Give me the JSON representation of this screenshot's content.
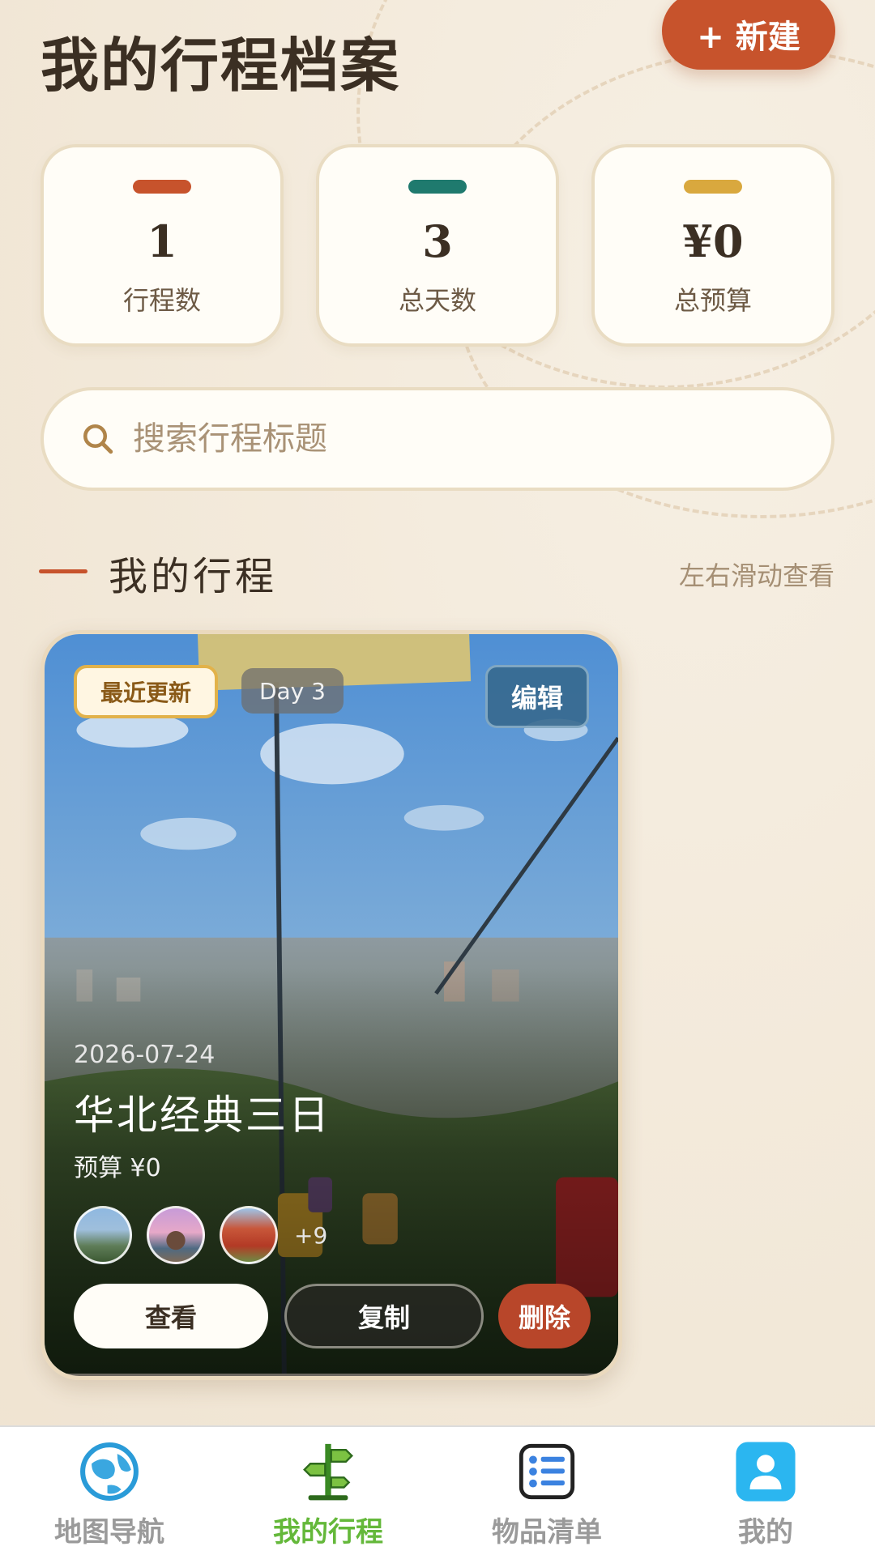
{
  "header": {
    "title": "我的行程档案",
    "new_button_label": "+ 新建"
  },
  "stats": [
    {
      "value": "1",
      "label": "行程数",
      "color": "#c7532c"
    },
    {
      "value": "3",
      "label": "总天数",
      "color": "#1f7a6e"
    },
    {
      "value": "¥0",
      "label": "总预算",
      "color": "#d9a83e"
    }
  ],
  "search": {
    "placeholder": "搜索行程标题",
    "icon": "search-icon"
  },
  "section": {
    "title": "我的行程",
    "hint": "左右滑动查看"
  },
  "trip_card": {
    "tag_recent": "最近更新",
    "tag_day": "Day 3",
    "edit_label": "编辑",
    "date": "2026-07-24",
    "name": "华北经典三日",
    "budget": "预算 ¥0",
    "more_count": "+9",
    "actions": {
      "view": "查看",
      "copy": "复制",
      "delete": "删除"
    }
  },
  "bottom_nav": [
    {
      "label": "地图导航",
      "icon": "globe-icon",
      "active": false
    },
    {
      "label": "我的行程",
      "icon": "signpost-icon",
      "active": true
    },
    {
      "label": "物品清单",
      "icon": "checklist-icon",
      "active": false
    },
    {
      "label": "我的",
      "icon": "user-icon",
      "active": false
    }
  ]
}
